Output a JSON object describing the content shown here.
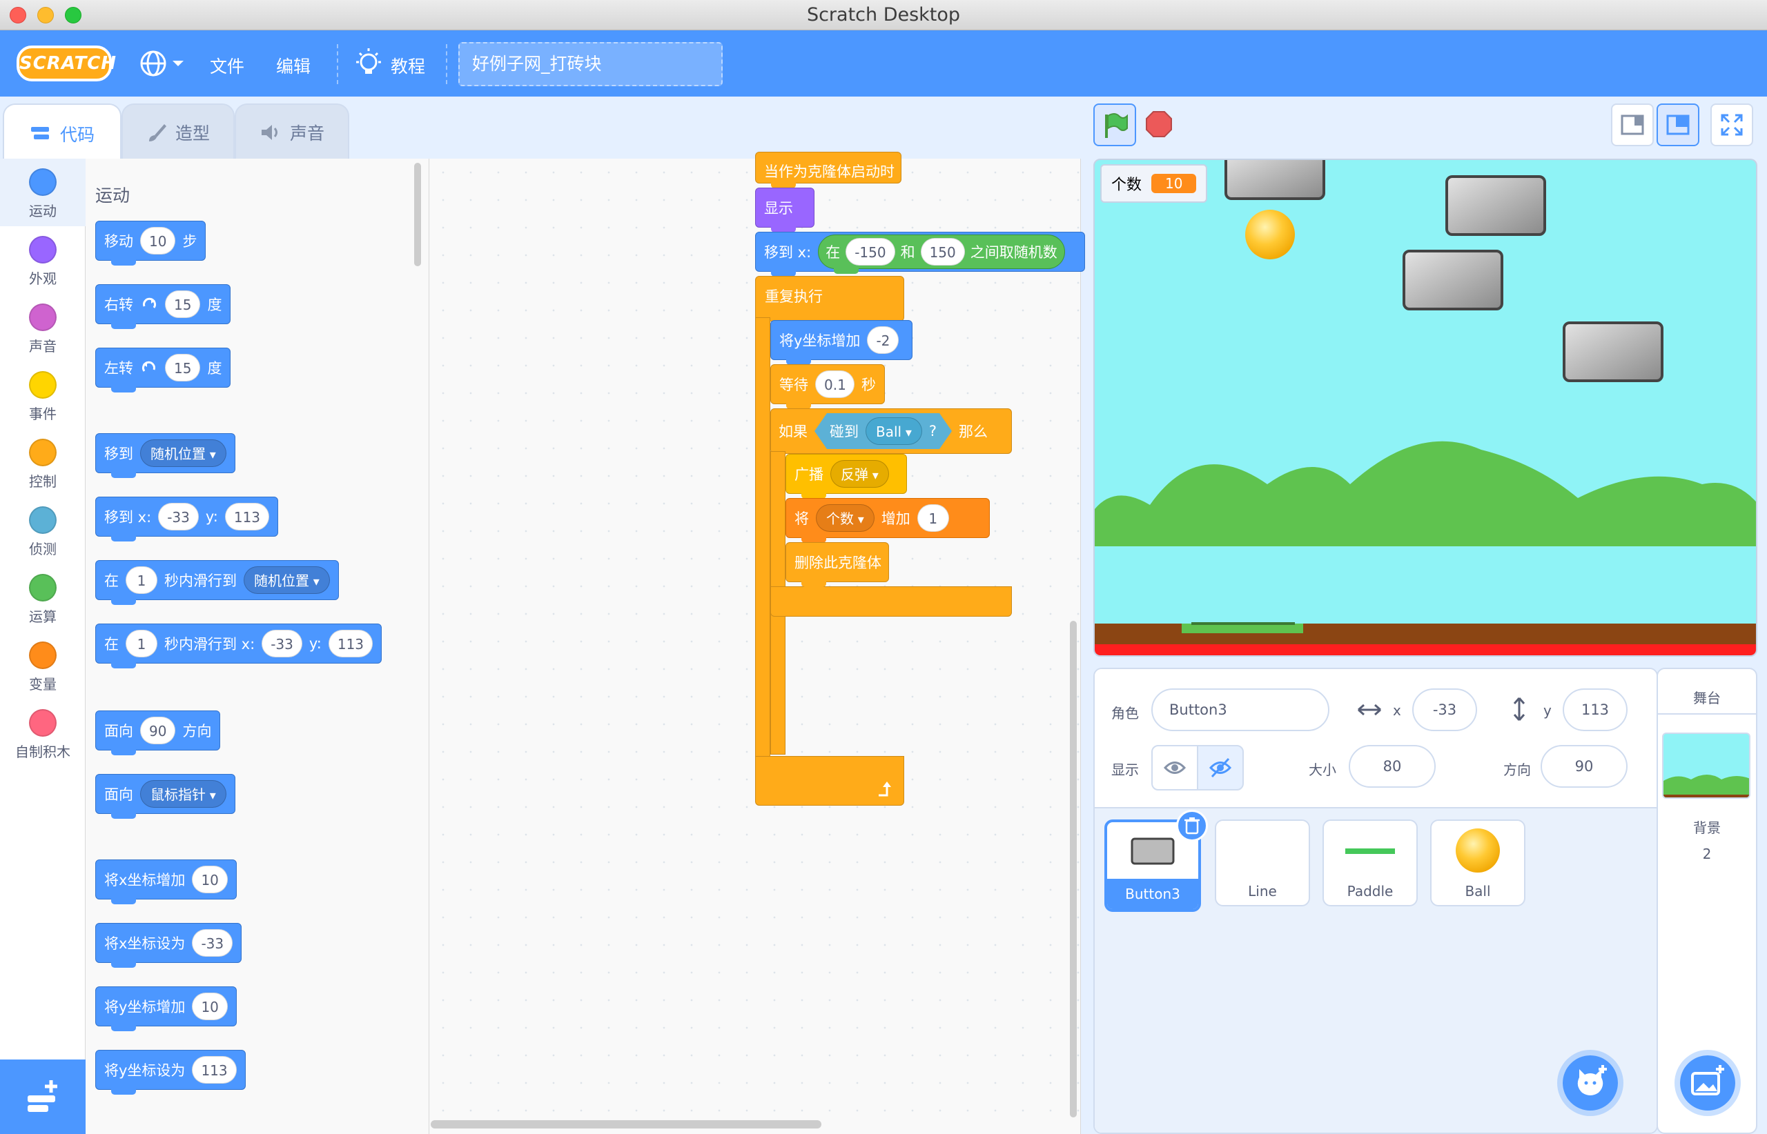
{
  "window": {
    "title": "Scratch Desktop"
  },
  "menubar": {
    "logo": "SCRATCH",
    "file": "文件",
    "edit": "编辑",
    "tutorials": "教程",
    "project_title": "好例子网_打砖块"
  },
  "tabs": [
    {
      "label": "代码",
      "icon": "code-icon"
    },
    {
      "label": "造型",
      "icon": "brush-icon"
    },
    {
      "label": "声音",
      "icon": "speaker-icon"
    }
  ],
  "categories": [
    {
      "label": "运动",
      "color": "#4c97ff"
    },
    {
      "label": "外观",
      "color": "#9966ff"
    },
    {
      "label": "声音",
      "color": "#cf63cf"
    },
    {
      "label": "事件",
      "color": "#ffd500"
    },
    {
      "label": "控制",
      "color": "#ffab19"
    },
    {
      "label": "侦测",
      "color": "#5cb1d6"
    },
    {
      "label": "运算",
      "color": "#59c059"
    },
    {
      "label": "变量",
      "color": "#ff8c1a"
    },
    {
      "label": "自制积木",
      "color": "#ff6680"
    }
  ],
  "palette": {
    "heading": "运动",
    "move": {
      "a": "移动",
      "v": "10",
      "b": "步"
    },
    "turn_right": {
      "a": "右转",
      "v": "15",
      "b": "度"
    },
    "turn_left": {
      "a": "左转",
      "v": "15",
      "b": "度"
    },
    "goto": {
      "a": "移到",
      "dd": "随机位置"
    },
    "goto_xy": {
      "a": "移到 x:",
      "x": "-33",
      "b": "y:",
      "y": "113"
    },
    "glide": {
      "a": "在",
      "v": "1",
      "b": "秒内滑行到",
      "dd": "随机位置"
    },
    "glide_xy": {
      "a": "在",
      "v": "1",
      "b": "秒内滑行到 x:",
      "x": "-33",
      "c": "y:",
      "y": "113"
    },
    "point": {
      "a": "面向",
      "v": "90",
      "b": "方向"
    },
    "point_towards": {
      "a": "面向",
      "dd": "鼠标指针"
    },
    "change_x": {
      "a": "将x坐标增加",
      "v": "10"
    },
    "set_x": {
      "a": "将x坐标设为",
      "v": "-33"
    },
    "change_y": {
      "a": "将y坐标增加",
      "v": "10"
    },
    "set_y": {
      "a": "将y坐标设为",
      "v": "113"
    }
  },
  "script": {
    "hat": "当作为克隆体启动时",
    "show": "显示",
    "goto_x": "移到 x:",
    "random_a": "在",
    "random_min": "-150",
    "random_and": "和",
    "random_max": "150",
    "random_b": "之间取随机数",
    "forever": "重复执行",
    "change_y": "将y坐标增加",
    "change_y_v": "-2",
    "wait": "等待",
    "wait_v": "0.1",
    "wait_unit": "秒",
    "if": "如果",
    "touching": "碰到",
    "touching_dd": "Ball",
    "q": "?",
    "then": "那么",
    "broadcast": "广播",
    "broadcast_dd": "反弹",
    "change_var": "将",
    "var_dd": "个数",
    "change_by": "增加",
    "change_v": "1",
    "delete_clone": "删除此克隆体"
  },
  "stage": {
    "monitor_label": "个数",
    "monitor_value": "10"
  },
  "sprite_info": {
    "sprite_label": "角色",
    "sprite_name": "Button3",
    "x_label": "x",
    "x": "-33",
    "y_label": "y",
    "y": "113",
    "show_label": "显示",
    "size_label": "大小",
    "size": "80",
    "direction_label": "方向",
    "direction": "90"
  },
  "sprites": [
    {
      "name": "Button3",
      "selected": true
    },
    {
      "name": "Line",
      "selected": false
    },
    {
      "name": "Paddle",
      "selected": false
    },
    {
      "name": "Ball",
      "selected": false
    }
  ],
  "stage_panel": {
    "title": "舞台",
    "backdrops_label": "背景",
    "backdrops_count": "2"
  },
  "colors": {
    "accent": "#4c97ff",
    "motion": "#4c97ff",
    "looks": "#9966ff",
    "control": "#ffab19",
    "sensing": "#5cb1d6",
    "operators": "#59c059",
    "variables": "#ff8c1a"
  }
}
